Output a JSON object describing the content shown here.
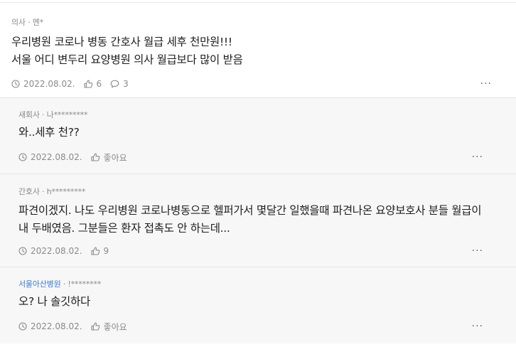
{
  "post": {
    "meta": {
      "job": "의사",
      "sep": " · ",
      "author": "멘*"
    },
    "lines": [
      "우리병원 코로나 병동 간호사 월급 세후 천만원!!!",
      "서울 어디 변두리 요양병원 의사 월급보다 많이 받음"
    ],
    "date": "2022.08.02.",
    "likes": "6",
    "comments": "3",
    "more": "···"
  },
  "comments": [
    {
      "job": "새회사",
      "sep": " · ",
      "author": "나*********",
      "lines": [
        "와..세후 천??"
      ],
      "date": "2022.08.02.",
      "like_label": "좋아요",
      "more": "···"
    },
    {
      "job": "간호사",
      "sep": " · ",
      "author": "h*********",
      "lines": [
        "파견이겠지. 나도 우리병원 코로나병동으로 헬퍼가서 몇달간 일했을때 파견나온 요양보호사 분들 월급이",
        "내 두배였음. 그분들은 환자 접촉도 안 하는데..."
      ],
      "date": "2022.08.02.",
      "like_label": "9",
      "more": "···"
    },
    {
      "job": "서울아산병원",
      "sep": " · ",
      "author": "!********",
      "lines": [
        "오? 나 솔깃하다"
      ],
      "date": "2022.08.02.",
      "like_label": "좋아요",
      "more": "···"
    }
  ],
  "colors": {
    "company_link": "#3f7ad0",
    "comment_bg": "#f7f7f7",
    "meta_gray": "#8a8a8a"
  }
}
